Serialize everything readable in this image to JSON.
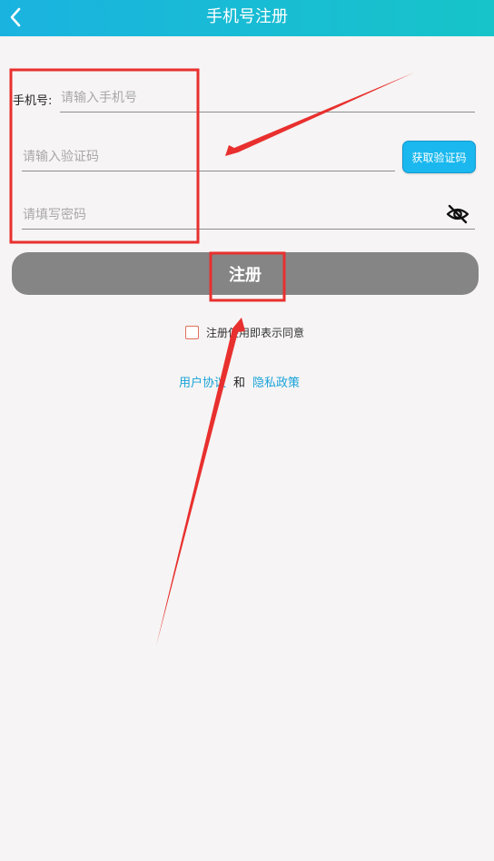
{
  "header": {
    "title": "手机号注册"
  },
  "form": {
    "phone_label": "手机号:",
    "phone_placeholder": "请输入手机号",
    "code_placeholder": "请输入验证码",
    "get_code_label": "获取验证码",
    "password_placeholder": "请填写密码",
    "register_label": "注册"
  },
  "agreement": {
    "text": "注册使用即表示同意",
    "link_user": "用户协议",
    "and": "和",
    "link_privacy": "隐私政策"
  },
  "annotation": {
    "color": "#e8302e"
  },
  "colors": {
    "header_start": "#1ab3e0",
    "header_end": "#17c4c9",
    "button_gray": "#858585",
    "link": "#1aa3d9",
    "code_button": "#1ab8ee"
  }
}
